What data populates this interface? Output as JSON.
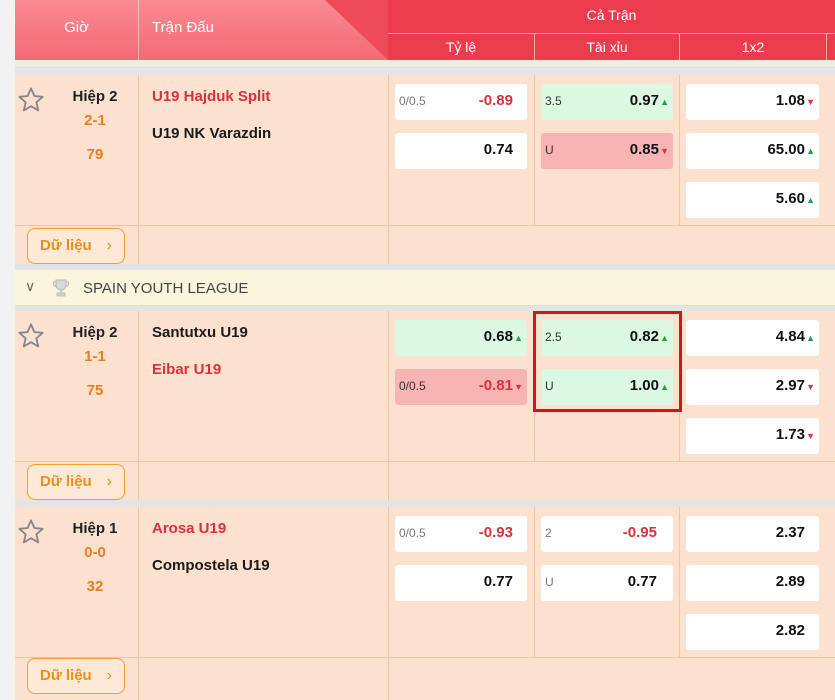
{
  "header": {
    "col_time": "Giờ",
    "col_match": "Trận Đấu",
    "col_full": "Cả Trận",
    "sub_handicap": "Tỷ lệ",
    "sub_overunder": "Tài xỉu",
    "sub_1x2": "1x2"
  },
  "data_button": "Dữ liệu",
  "matches": [
    {
      "period": "Hiệp 2",
      "score": "2-1",
      "minute": "79",
      "home": "U19 Hajduk Split",
      "away": "U19 NK Varazdin",
      "hdp": {
        "line": "0/0.5",
        "home": "-0.89",
        "away": "0.74"
      },
      "ou": {
        "line": "3.5",
        "over": "0.97",
        "under_label": "U",
        "under": "0.85"
      },
      "x12": [
        "1.08",
        "65.00",
        "5.60"
      ]
    },
    {
      "period": "Hiệp 2",
      "score": "1-1",
      "minute": "75",
      "home": "Santutxu U19",
      "away": "Eibar U19",
      "hdp": {
        "line": "0/0.5",
        "home": "0.68",
        "away": "-0.81"
      },
      "ou": {
        "line": "2.5",
        "over": "0.82",
        "under_label": "U",
        "under": "1.00"
      },
      "x12": [
        "4.84",
        "2.97",
        "1.73"
      ]
    },
    {
      "period": "Hiệp 1",
      "score": "0-0",
      "minute": "32",
      "home": "Arosa U19",
      "away": "Compostela U19",
      "hdp": {
        "line": "0/0.5",
        "home": "-0.93",
        "away": "0.77"
      },
      "ou": {
        "line": "2",
        "over": "-0.95",
        "under_label": "U",
        "under": "0.77"
      },
      "x12": [
        "2.37",
        "2.89",
        "2.82"
      ]
    }
  ],
  "league": {
    "name": "SPAIN YOUTH LEAGUE"
  },
  "colors": {
    "header_red": "#ea3c4d",
    "row_bg": "#fde1cf",
    "odds_up": "#22a04a",
    "odds_down": "#e0303a",
    "highlight": "#d2141e"
  }
}
